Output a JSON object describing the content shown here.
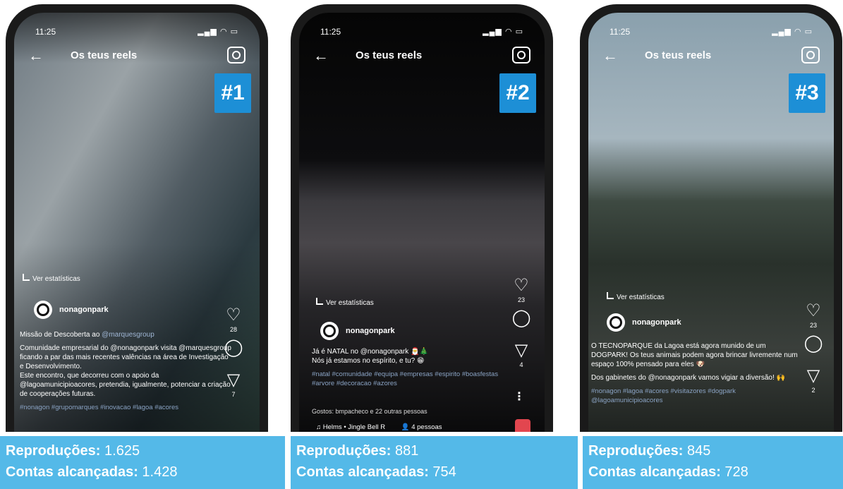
{
  "status_time": "11:25",
  "header": {
    "title": "Os teus reels"
  },
  "reels": [
    {
      "badge": "#1",
      "stats_link": "Ver estatísticas",
      "username": "nonagonpark",
      "caption_title_pre": "Missão de Descoberta ao ",
      "caption_title_mention": "@marquesgroup",
      "caption_body": "Comunidade empresarial do @nonagonpark visita @marquesgroup ficando a par das mais recentes valências na área de Investigação e Desenvolvimento.",
      "caption_body2": "Este encontro, que decorreu com o apoio da @lagoamunicipioacores, pretendia, igualmente, potenciar a criação de cooperações futuras.",
      "hashtags": "#nonagon #grupomarques #inovacao #lagoa #acores",
      "likes_count": "28",
      "share_count": "7",
      "plays_label": "Reproduções:",
      "plays": "1.625",
      "reach_label": "Contas alcançadas:",
      "reach": "1.428"
    },
    {
      "badge": "#2",
      "stats_link": "Ver estatísticas",
      "username": "nonagonpark",
      "caption_line1": "Já é NATAL no @nonagonpark 🎅🎄",
      "caption_line2": "Nós já estamos no espírito, e tu? 😁",
      "hashtags": "#natal #comunidade #equipa #empresas #espirito #boasfestas #arvore #decoracao #azores",
      "liked_by": "Gostos: bmpacheco e 22 outras pessoas",
      "audio": "Helms • Jingle Bell R",
      "audio_people": "4 pessoas",
      "likes_count": "23",
      "share_count": "4",
      "plays_label": "Reproduções:",
      "plays": "881",
      "reach_label": "Contas alcançadas:",
      "reach": "754"
    },
    {
      "badge": "#3",
      "stats_link": "Ver estatísticas",
      "username": "nonagonpark",
      "caption_line1": "O TECNOPARQUE da Lagoa está agora munido de um DOGPARK! Os teus animais podem agora brincar livremente num espaço 100% pensado para eles 🐶",
      "caption_line2": "Dos gabinetes do @nonagonpark vamos vigiar a diversão! 🙌",
      "hashtags": "#nonagon #lagoa #acores #visitazores #dogpark @lagoamunicipioacores",
      "likes_count": "23",
      "share_count": "2",
      "plays_label": "Reproduções:",
      "plays": "845",
      "reach_label": "Contas alcançadas:",
      "reach": "728"
    }
  ]
}
